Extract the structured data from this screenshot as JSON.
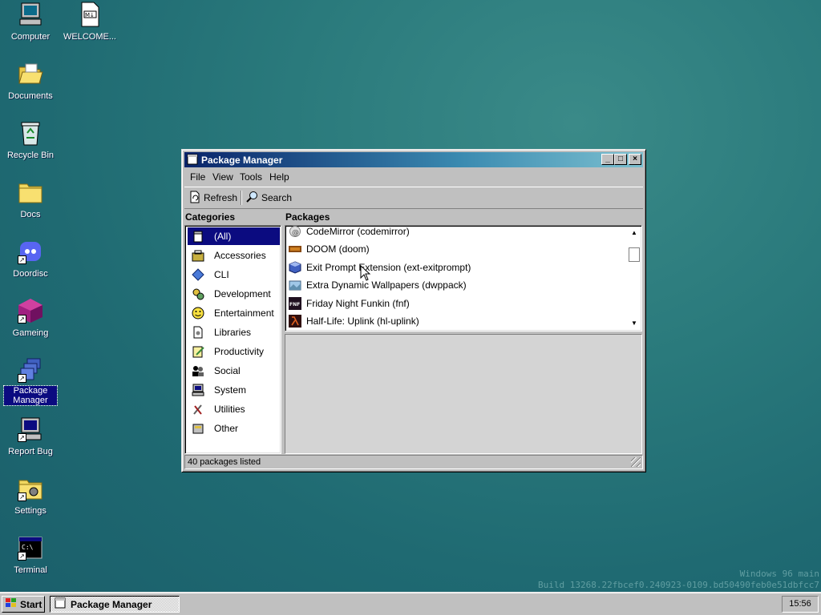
{
  "desktop": {
    "icons": [
      {
        "label": "Computer"
      },
      {
        "label": "WELCOME..."
      },
      {
        "label": "Documents"
      },
      {
        "label": "Recycle Bin"
      },
      {
        "label": "Docs"
      },
      {
        "label": "Doordisc"
      },
      {
        "label": "Gameing"
      },
      {
        "label": "Package Manager"
      },
      {
        "label": "Report Bug"
      },
      {
        "label": "Settings"
      },
      {
        "label": "Terminal"
      }
    ],
    "watermark_line1": "Windows 96 main",
    "watermark_line2": "Build 13268.22fbcef0.240923-0109.bd50490feb0e51dbfcc7"
  },
  "window": {
    "title": "Package Manager",
    "controls": {
      "minimize": "_",
      "maximize": "□",
      "close": "×"
    },
    "menu": [
      "File",
      "View",
      "Tools",
      "Help"
    ],
    "toolbar": {
      "refresh_label": "Refresh",
      "search_label": "Search"
    },
    "categories_label": "Categories",
    "packages_label": "Packages",
    "categories": [
      {
        "label": "(All)",
        "selected": true
      },
      {
        "label": "Accessories"
      },
      {
        "label": "CLI"
      },
      {
        "label": "Development"
      },
      {
        "label": "Entertainment"
      },
      {
        "label": "Libraries"
      },
      {
        "label": "Productivity"
      },
      {
        "label": "Social"
      },
      {
        "label": "System"
      },
      {
        "label": "Utilities"
      },
      {
        "label": "Other"
      }
    ],
    "packages": [
      {
        "label": "CodeMirror (codemirror)"
      },
      {
        "label": "DOOM (doom)"
      },
      {
        "label": "Exit Prompt Extension (ext-exitprompt)"
      },
      {
        "label": "Extra Dynamic Wallpapers (dwppack)"
      },
      {
        "label": "Friday Night Funkin (fnf)"
      },
      {
        "label": "Half-Life: Uplink (hl-uplink)"
      }
    ],
    "status": "40 packages listed"
  },
  "taskbar": {
    "start_label": "Start",
    "task_label": "Package Manager",
    "clock": "15:56"
  }
}
